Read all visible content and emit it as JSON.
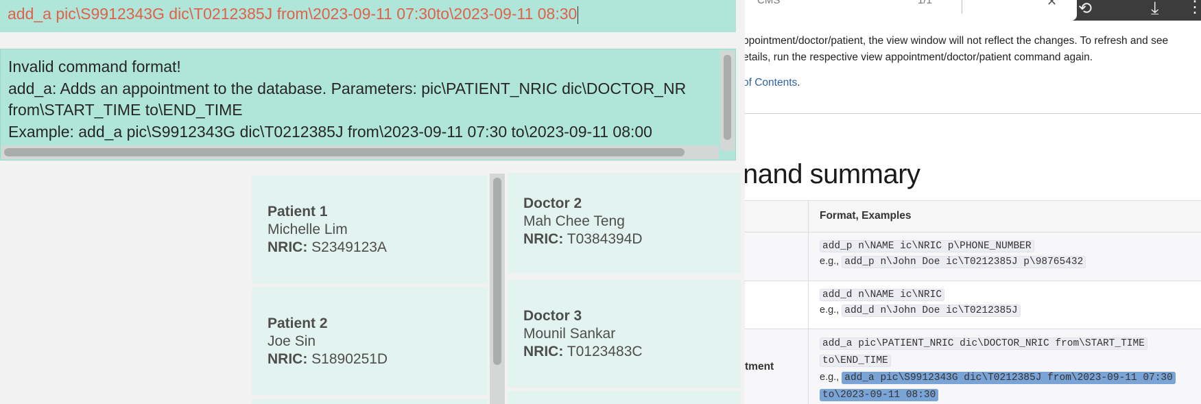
{
  "command_box": {
    "value": "add_a pic\\S9912343G dic\\T0212385J from\\2023-09-11 07:30to\\2023-09-11 08:30"
  },
  "result_display": {
    "lines": [
      "Invalid command format!",
      "add_a: Adds an appointment to the database. Parameters: pic\\PATIENT_NRIC dic\\DOCTOR_NR",
      "from\\START_TIME to\\END_TIME",
      "Example: add_a pic\\S9912343G dic\\T0212385J from\\2023-09-11 07:30 to\\2023-09-11 08:00"
    ]
  },
  "patients": [
    {
      "title": "Patient 1",
      "name": "Michelle Lim",
      "nric_label": "NRIC:",
      "nric": "S2349123A"
    },
    {
      "title": "Patient 2",
      "name": "Joe Sin",
      "nric_label": "NRIC:",
      "nric": "S1890251D"
    }
  ],
  "doctors": [
    {
      "title": "Doctor 2",
      "name": "Mah Chee Teng",
      "nric_label": "NRIC:",
      "nric": "T0384394D"
    },
    {
      "title": "Doctor 3",
      "name": "Mounil Sankar",
      "nric_label": "NRIC:",
      "nric": "T0123483C"
    }
  ],
  "browser": {
    "find_text": "CMS",
    "find_count": "1/1",
    "icons": [
      "history-icon",
      "download-icon",
      "more-icon",
      "close-icon"
    ]
  },
  "doc": {
    "note_line1": "ppointment/doctor/patient, the view window will not reflect the changes. To refresh and see",
    "note_line2": "etails, run the respective view appointment/doctor/patient command again.",
    "toc_link": "of Contents",
    "toc_period": ".",
    "heading": "nand summary",
    "table": {
      "header_format": "Format, Examples",
      "rows": [
        {
          "action_partial": ":",
          "format": "add_p n\\NAME ic\\NRIC p\\PHONE_NUMBER",
          "eg_prefix": "e.g.,",
          "example": "add_p n\\John Doe ic\\T0212385J p\\98765432"
        },
        {
          "action_partial": "",
          "format": "add_d n\\NAME ic\\NRIC",
          "eg_prefix": "e.g.,",
          "example": "add_d n\\John Doe ic\\T0212385J"
        },
        {
          "action_partial": "tment",
          "format_line1": "add_a pic\\PATIENT_NRIC dic\\DOCTOR_NRIC from\\START_TIME",
          "format_line2": "to\\END_TIME",
          "eg_prefix": "e.g.,",
          "example_line1": "add_a pic\\S9912343G dic\\T0212385J from\\2023-09-11 07:30",
          "example_line2": "to\\2023-09-11 08:30"
        }
      ]
    }
  },
  "colors": {
    "panel_teal": "#b0e5d9",
    "card_bg": "#e3f4f0",
    "command_text": "#e0614a",
    "link_blue": "#2f5fa6",
    "highlight": "#7aa3d6"
  }
}
